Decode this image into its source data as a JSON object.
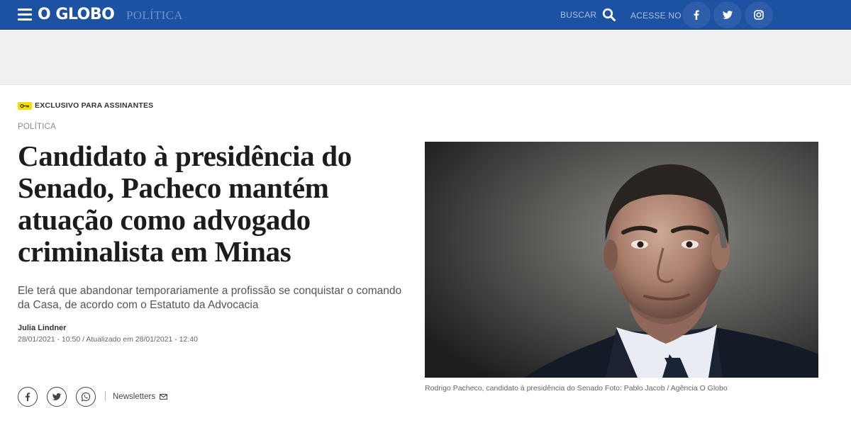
{
  "header": {
    "logo": "O GLOBO",
    "section": "POLÍTICA",
    "search_label": "BUSCAR",
    "acesse_label": "ACESSE NO",
    "social_icons": [
      "facebook-icon",
      "twitter-icon",
      "instagram-icon"
    ],
    "bg_color": "#1d51a2"
  },
  "article": {
    "exclusive_label": "EXCLUSIVO PARA ASSINANTES",
    "kicker": "POLÍTICA",
    "headline": "Candidato à presidência do Senado, Pacheco mantém atuação como advogado criminalista em Minas",
    "subtitle": "Ele terá que abandonar temporariamente a profissão se conquistar o comando da Casa, de acordo com o Estatuto da Advocacia",
    "author": "Julia Lindner",
    "dates": "28/01/2021 - 10:50 / Atualizado em 28/01/2021 - 12:40",
    "share_icons": [
      "facebook-icon",
      "twitter-icon",
      "whatsapp-icon"
    ],
    "newsletters_label": "Newsletters",
    "photo_caption": "Rodrigo Pacheco, candidato à presidência do Senado Foto: Pablo Jacob / Agência O Globo"
  }
}
